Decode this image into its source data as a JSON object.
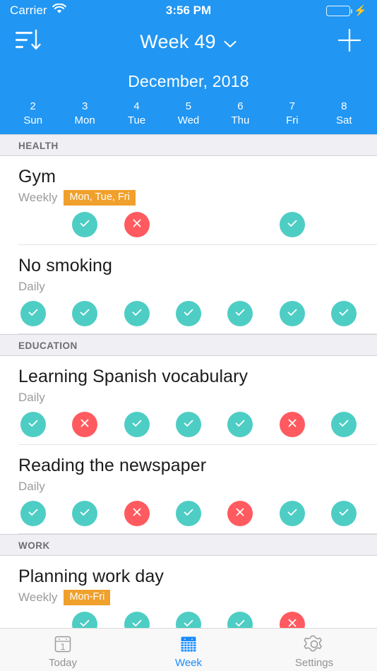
{
  "status_bar": {
    "carrier": "Carrier",
    "wifi_icon": "wifi-icon",
    "time": "3:56 PM",
    "battery_icon": "battery-icon",
    "charging_icon": "lightning-bolt-icon"
  },
  "nav_bar": {
    "sort_icon": "sort-descending-icon",
    "title": "Week 49",
    "chevron_icon": "chevron-down-icon",
    "add_icon": "plus-icon"
  },
  "week_header": {
    "month": "December, 2018",
    "days": [
      {
        "num": "2",
        "name": "Sun"
      },
      {
        "num": "3",
        "name": "Mon"
      },
      {
        "num": "4",
        "name": "Tue"
      },
      {
        "num": "5",
        "name": "Wed"
      },
      {
        "num": "6",
        "name": "Thu"
      },
      {
        "num": "7",
        "name": "Fri"
      },
      {
        "num": "8",
        "name": "Sat"
      }
    ]
  },
  "colors": {
    "accent_blue": "#2196F3",
    "done_teal": "#4ECDC4",
    "fail_red": "#FF5A5F",
    "badge_orange": "#F0A02C",
    "tab_active_blue": "#1a8cff"
  },
  "sections": [
    {
      "title": "HEALTH",
      "habits": [
        {
          "name": "Gym",
          "frequency": "Weekly",
          "badge": "Mon, Tue, Fri",
          "marks": [
            "none",
            "done",
            "fail",
            "none",
            "none",
            "done",
            "none"
          ]
        },
        {
          "name": "No smoking",
          "frequency": "Daily",
          "badge": null,
          "marks": [
            "done",
            "done",
            "done",
            "done",
            "done",
            "done",
            "done"
          ]
        }
      ]
    },
    {
      "title": "EDUCATION",
      "habits": [
        {
          "name": "Learning Spanish vocabulary",
          "frequency": "Daily",
          "badge": null,
          "marks": [
            "done",
            "fail",
            "done",
            "done",
            "done",
            "fail",
            "done"
          ]
        },
        {
          "name": "Reading the newspaper",
          "frequency": "Daily",
          "badge": null,
          "marks": [
            "done",
            "done",
            "fail",
            "done",
            "fail",
            "done",
            "done"
          ]
        }
      ]
    },
    {
      "title": "WORK",
      "habits": [
        {
          "name": "Planning work day",
          "frequency": "Weekly",
          "badge": "Mon-Fri",
          "marks": [
            "none",
            "done",
            "done",
            "done",
            "done",
            "fail",
            "none"
          ]
        }
      ]
    }
  ],
  "tab_bar": {
    "items": [
      {
        "label": "Today",
        "icon": "calendar-day-icon",
        "active": false
      },
      {
        "label": "Week",
        "icon": "calendar-week-icon",
        "active": true
      },
      {
        "label": "Settings",
        "icon": "gear-icon",
        "active": false
      }
    ]
  }
}
